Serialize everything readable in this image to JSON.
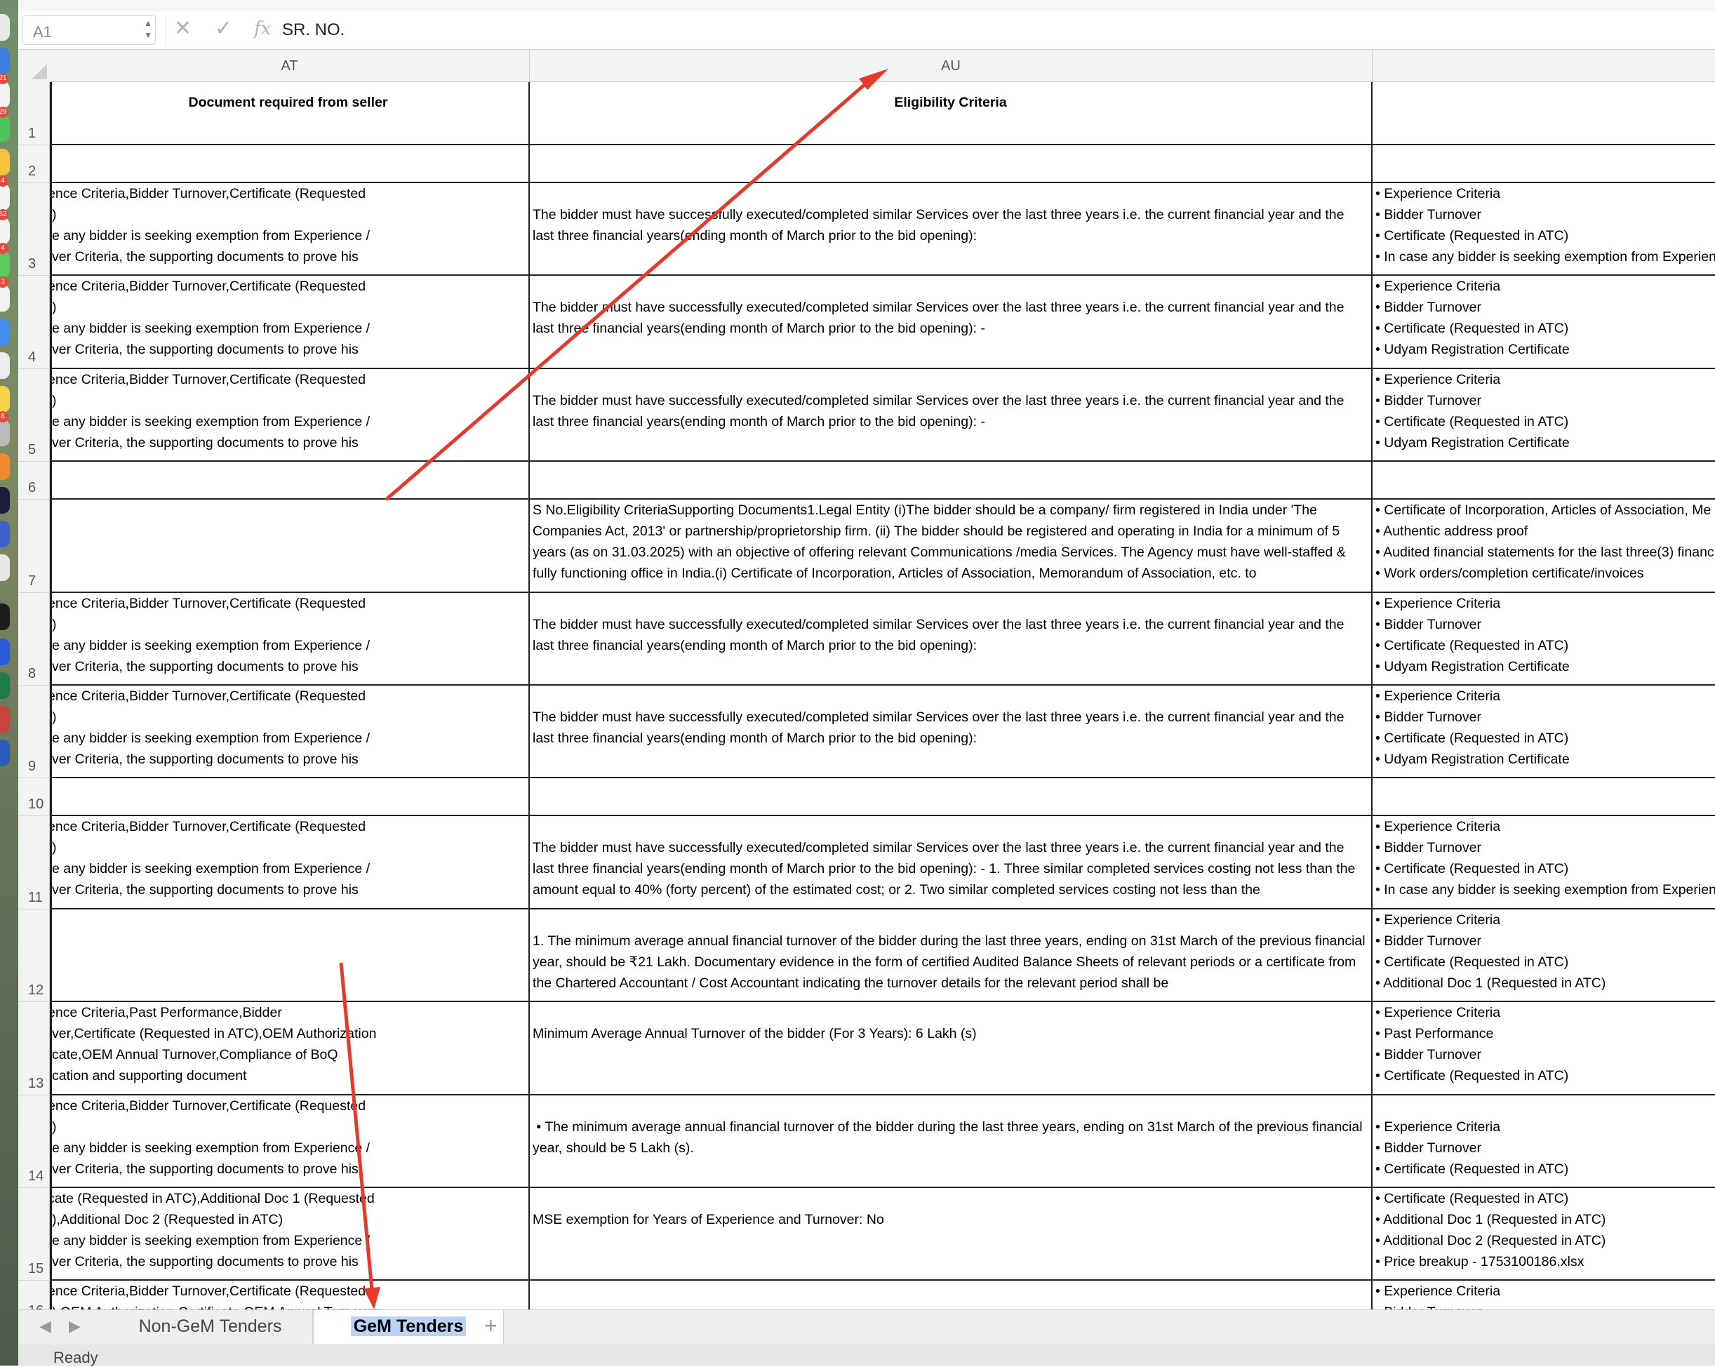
{
  "formula_bar": {
    "cell_reference": "A1",
    "cancel_symbol": "✕",
    "enter_symbol": "✓",
    "function_symbol": "fx",
    "content": "SR. NO."
  },
  "columns": [
    {
      "id": "AT",
      "label": "AT"
    },
    {
      "id": "AU",
      "label": "AU"
    },
    {
      "id": "AV",
      "label": ""
    }
  ],
  "rows": [
    {
      "num": "1",
      "at": "Document required from seller",
      "au": "Eligibility Criteria",
      "av": ""
    },
    {
      "num": "2",
      "at": "",
      "au": "",
      "av": ""
    },
    {
      "num": "3",
      "at": "ence Criteria,Bidder Turnover,Certificate (Requested\n)\ne any bidder is seeking exemption from Experience /\nver Criteria, the supporting documents to prove his",
      "au": "\nThe bidder must have successfully executed/completed similar Services over the last three years i.e. the current financial year and the last three financial years(ending month of March prior to the bid opening):",
      "av": "• Experience Criteria\n• Bidder Turnover\n• Certificate (Requested in ATC)\n• In case any bidder is seeking exemption from Experience"
    },
    {
      "num": "4",
      "at": "ence Criteria,Bidder Turnover,Certificate (Requested\n)\ne any bidder is seeking exemption from Experience /\nver Criteria, the supporting documents to prove his",
      "au": "\nThe bidder must have successfully executed/completed similar Services over the last three years i.e. the current financial year and the last three financial years(ending month of March prior to the bid opening): -",
      "av": "• Experience Criteria\n• Bidder Turnover\n• Certificate (Requested in ATC)\n• Udyam Registration Certificate"
    },
    {
      "num": "5",
      "at": "ence Criteria,Bidder Turnover,Certificate (Requested\n)\ne any bidder is seeking exemption from Experience /\nver Criteria, the supporting documents to prove his",
      "au": "\nThe bidder must have successfully executed/completed similar Services over the last three years i.e. the current financial year and the last three financial years(ending month of March prior to the bid opening): -",
      "av": "• Experience Criteria\n• Bidder Turnover\n• Certificate (Requested in ATC)\n• Udyam Registration Certificate"
    },
    {
      "num": "6",
      "at": "",
      "au": "",
      "av": ""
    },
    {
      "num": "7",
      "at": "",
      "au": "S No.Eligibility CriteriaSupporting Documents1.Legal Entity (i)The bidder should be a company/ firm registered in India under 'The Companies Act, 2013' or partnership/proprietorship firm. (ii) The bidder should be registered and operating in India for a minimum of 5 years (as on 31.03.2025) with an objective of offering relevant Communications /media Services. The Agency must have well-staffed & fully functioning office in India.(i) Certificate of Incorporation, Articles of Association, Memorandum of Association, etc. to",
      "av": "• Certificate of Incorporation, Articles of Association, Me\n• Authentic address proof\n• Audited financial statements for the last three(3) financ\n• Work orders/completion certificate/invoices"
    },
    {
      "num": "8",
      "at": "ence Criteria,Bidder Turnover,Certificate (Requested\n)\ne any bidder is seeking exemption from Experience /\nver Criteria, the supporting documents to prove his",
      "au": "\nThe bidder must have successfully executed/completed similar Services over the last three years i.e. the current financial year and the last three financial years(ending month of March prior to the bid opening):",
      "av": "• Experience Criteria\n• Bidder Turnover\n• Certificate (Requested in ATC)\n• Udyam Registration Certificate"
    },
    {
      "num": "9",
      "at": "ence Criteria,Bidder Turnover,Certificate (Requested\n)\ne any bidder is seeking exemption from Experience /\nver Criteria, the supporting documents to prove his",
      "au": "\nThe bidder must have successfully executed/completed similar Services over the last three years i.e. the current financial year and the last three financial years(ending month of March prior to the bid opening):",
      "av": "• Experience Criteria\n• Bidder Turnover\n• Certificate (Requested in ATC)\n• Udyam Registration Certificate"
    },
    {
      "num": "10",
      "at": "",
      "au": "",
      "av": ""
    },
    {
      "num": "11",
      "at": "ence Criteria,Bidder Turnover,Certificate (Requested\n)\ne any bidder is seeking exemption from Experience /\nver Criteria, the supporting documents to prove his",
      "au": "\nThe bidder must have successfully executed/completed similar Services over the last three years i.e. the current financial year and the last three financial years(ending month of March prior to the bid opening): - 1. Three similar completed services costing not less than the amount equal to 40% (forty percent) of the estimated cost; or 2. Two similar completed services costing not less than the",
      "av": "• Experience Criteria\n• Bidder Turnover\n• Certificate (Requested in ATC)\n• In case any bidder is seeking exemption from Experience"
    },
    {
      "num": "12",
      "at": "",
      "au": "\n1. The minimum average annual financial turnover of the bidder during the last three years, ending on 31st March of the previous financial year, should be ₹21 Lakh. Documentary evidence in the form of certified Audited Balance Sheets of relevant periods or a certificate from the Chartered Accountant / Cost Accountant indicating the turnover details for the relevant period shall be",
      "av": "• Experience Criteria\n• Bidder Turnover\n• Certificate (Requested in ATC)\n• Additional Doc 1 (Requested in ATC)"
    },
    {
      "num": "13",
      "at": "ence Criteria,Past Performance,Bidder\nver,Certificate (Requested in ATC),OEM Authorization\ncate,OEM Annual Turnover,Compliance of BoQ\ncation and supporting document",
      "au": "\nMinimum Average Annual Turnover of the bidder (For 3 Years): 6 Lakh (s)",
      "av": "• Experience Criteria\n• Past Performance\n• Bidder Turnover\n• Certificate (Requested in ATC)"
    },
    {
      "num": "14",
      "at": "ence Criteria,Bidder Turnover,Certificate (Requested\n)\ne any bidder is seeking exemption from Experience /\nver Criteria, the supporting documents to prove his",
      "au": "\n • The minimum average annual financial turnover of the bidder during the last three years, ending on 31st March of the previous financial year, should be 5 Lakh (s).",
      "av": "\n• Experience Criteria\n• Bidder Turnover\n• Certificate (Requested in ATC)"
    },
    {
      "num": "15",
      "at": "cate (Requested in ATC),Additional Doc 1 (Requested\n),Additional Doc 2 (Requested in ATC)\ne any bidder is seeking exemption from Experience /\nver Criteria, the supporting documents to prove his",
      "au": "\nMSE exemption for Years of Experience and Turnover: No",
      "av": "• Certificate (Requested in ATC)\n• Additional Doc 1 (Requested in ATC)\n• Additional Doc 2 (Requested in ATC)\n• Price breakup - 1753100186.xlsx"
    },
    {
      "num": "16",
      "at": "ence Criteria,Bidder Turnover,Certificate (Requested\n) OEM Authorization Certificate OEM Annual Turnover",
      "au": "",
      "av": "• Experience Criteria\n• Bidder Turnover"
    }
  ],
  "sheet_tabs": [
    {
      "label": "Non-GeM Tenders",
      "active": false
    },
    {
      "label": "GeM Tenders",
      "active": true
    }
  ],
  "add_sheet_symbol": "+",
  "status": "Ready",
  "dock_badges": [
    "21",
    "29",
    "4",
    "62",
    "4",
    "3",
    "8"
  ],
  "annotation_color": "#e8382a"
}
